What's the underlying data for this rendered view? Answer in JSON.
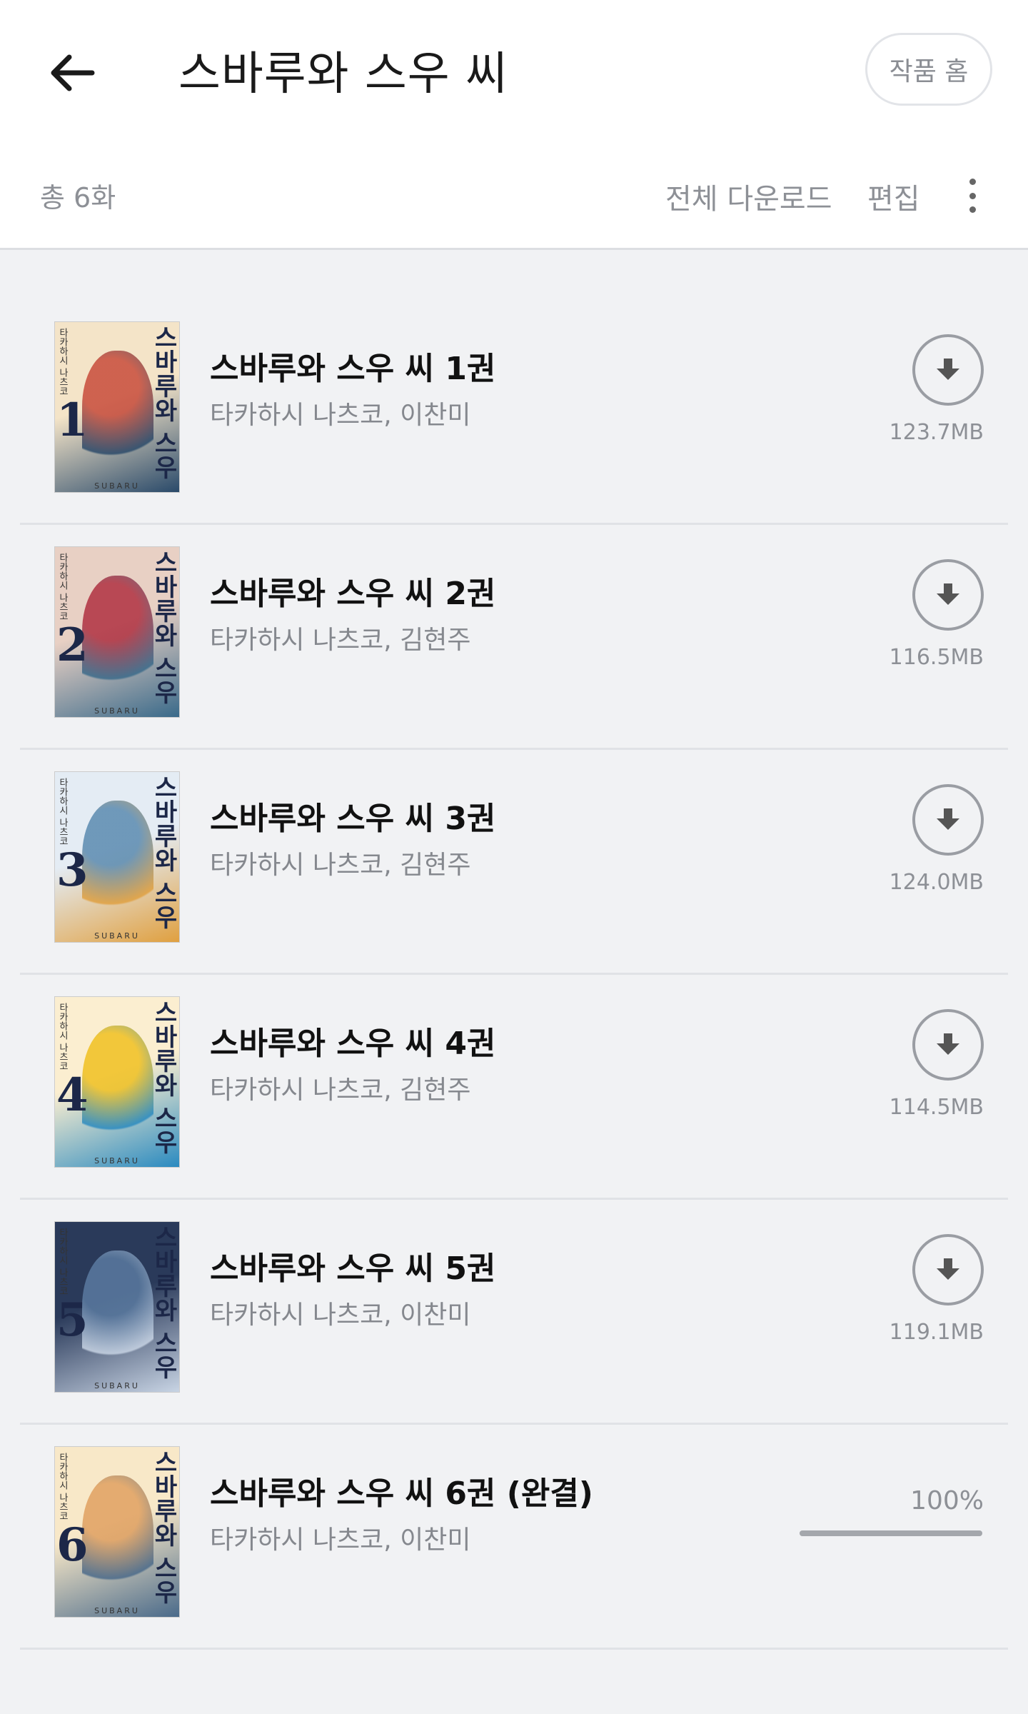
{
  "header": {
    "title": "스바루와 스우 씨",
    "home_button": "작품 홈",
    "count_label": "총 6화",
    "download_all": "전체 다운로드",
    "edit": "편집"
  },
  "volumes": [
    {
      "title": "스바루와 스우 씨 1권",
      "authors": "타카하시 나츠코, 이찬미",
      "size": "123.7MB",
      "cover_number": "1",
      "cover_title": "스바루와 스우",
      "cover_author": "타카하시 나츠코",
      "cover_footer": "SUBARU",
      "cover_colors": [
        "#f4e4c8",
        "#c84b3a",
        "#2a4a6a"
      ]
    },
    {
      "title": "스바루와 스우 씨 2권",
      "authors": "타카하시 나츠코, 김현주",
      "size": "116.5MB",
      "cover_number": "2",
      "cover_title": "스바루와 스우",
      "cover_author": "타카하시 나츠코",
      "cover_footer": "SUBARU",
      "cover_colors": [
        "#e8d0c4",
        "#b03040",
        "#3a6a8a"
      ]
    },
    {
      "title": "스바루와 스우 씨 3권",
      "authors": "타카하시 나츠코, 김현주",
      "size": "124.0MB",
      "cover_number": "3",
      "cover_title": "스바루와 스우",
      "cover_author": "타카하시 나츠코",
      "cover_footer": "SUBARU",
      "cover_colors": [
        "#e4ecf4",
        "#5a8ab0",
        "#e0a040"
      ]
    },
    {
      "title": "스바루와 스우 씨 4권",
      "authors": "타카하시 나츠코, 김현주",
      "size": "114.5MB",
      "cover_number": "4",
      "cover_title": "스바루와 스우",
      "cover_author": "타카하시 나츠코",
      "cover_footer": "SUBARU",
      "cover_colors": [
        "#fbeed0",
        "#f0c020",
        "#2a8ac0"
      ]
    },
    {
      "title": "스바루와 스우 씨 5권",
      "authors": "타카하시 나츠코, 이찬미",
      "size": "119.1MB",
      "cover_number": "5",
      "cover_title": "스바루와 스우",
      "cover_author": "타카하시 나츠코",
      "cover_footer": "SUBARU",
      "cover_colors": [
        "#2a3a5a",
        "#5a7aa0",
        "#c8d4e4"
      ]
    },
    {
      "title": "스바루와 스우 씨 6권 (완결)",
      "authors": "타카하시 나츠코, 이찬미",
      "progress_label": "100%",
      "progress": 1.0,
      "cover_number": "6",
      "cover_title": "스바루와 스우",
      "cover_author": "타카하시 나츠코",
      "cover_footer": "SUBARU",
      "cover_colors": [
        "#f8e8c8",
        "#e0a060",
        "#4a6a8a"
      ]
    }
  ],
  "icons": {
    "back": "arrow-left-icon",
    "more": "more-vertical-icon",
    "download": "download-icon"
  },
  "colors": {
    "background": "#f1f2f4",
    "header": "#ffffff",
    "muted_text": "#8d9096"
  }
}
